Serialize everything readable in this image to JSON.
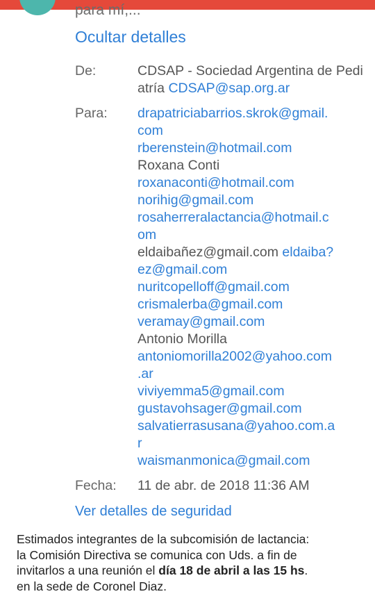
{
  "header": {
    "snippet": "para mí,..."
  },
  "details": {
    "hide_label": "Ocultar detalles",
    "from_label": "De:",
    "from_name": "CDSAP - Sociedad Argentina de Pediatría",
    "from_email": "CDSAP@sap.org.ar",
    "to_label": "Para:",
    "recipients": [
      {
        "type": "link",
        "lines": [
          "drapatriciabarrios.skrok@gmail.",
          "com"
        ]
      },
      {
        "type": "link",
        "lines": [
          "rberenstein@hotmail.com"
        ]
      },
      {
        "type": "name",
        "lines": [
          "Roxana Conti"
        ]
      },
      {
        "type": "link",
        "lines": [
          "roxanaconti@hotmail.com"
        ]
      },
      {
        "type": "link",
        "lines": [
          "norihig@gmail.com"
        ]
      },
      {
        "type": "link",
        "lines": [
          "rosaherreralactancia@hotmail.c",
          "om"
        ]
      },
      {
        "type": "mixed",
        "name": "eldaibañez@gmail.com",
        "link1": "eldaiba?",
        "link2": "ez@gmail.com"
      },
      {
        "type": "link",
        "lines": [
          "nuritcopelloff@gmail.com"
        ]
      },
      {
        "type": "link",
        "lines": [
          "crismalerba@gmail.com"
        ]
      },
      {
        "type": "link",
        "lines": [
          "veramay@gmail.com"
        ]
      },
      {
        "type": "name",
        "lines": [
          "Antonio Morilla"
        ]
      },
      {
        "type": "link",
        "lines": [
          "antoniomorilla2002@yahoo.com",
          ".ar"
        ]
      },
      {
        "type": "link",
        "lines": [
          "viviyemma5@gmail.com"
        ]
      },
      {
        "type": "link",
        "lines": [
          "gustavohsager@gmail.com"
        ]
      },
      {
        "type": "link",
        "lines": [
          "salvatierrasusana@yahoo.com.a",
          "r"
        ]
      },
      {
        "type": "link",
        "lines": [
          "waismanmonica@gmail.com"
        ]
      }
    ],
    "date_label": "Fecha:",
    "date_value": "11 de abr. de 2018 11:36 AM",
    "security_label": "Ver detalles de seguridad"
  },
  "body": {
    "line1": "Estimados integrantes de la subcomisión de lactancia:",
    "line2": "la Comisión Directiva se comunica con Uds. a fin de",
    "line3_pre": "invitarlos a una reunión el ",
    "line3_bold": "día 18 de abril a las 15 hs",
    "line3_post": ".",
    "line4": "en la sede de Coronel Diaz."
  },
  "colors": {
    "accent": "#e5493a",
    "link": "#2f7fd6",
    "avatar": "#4db6ac"
  }
}
